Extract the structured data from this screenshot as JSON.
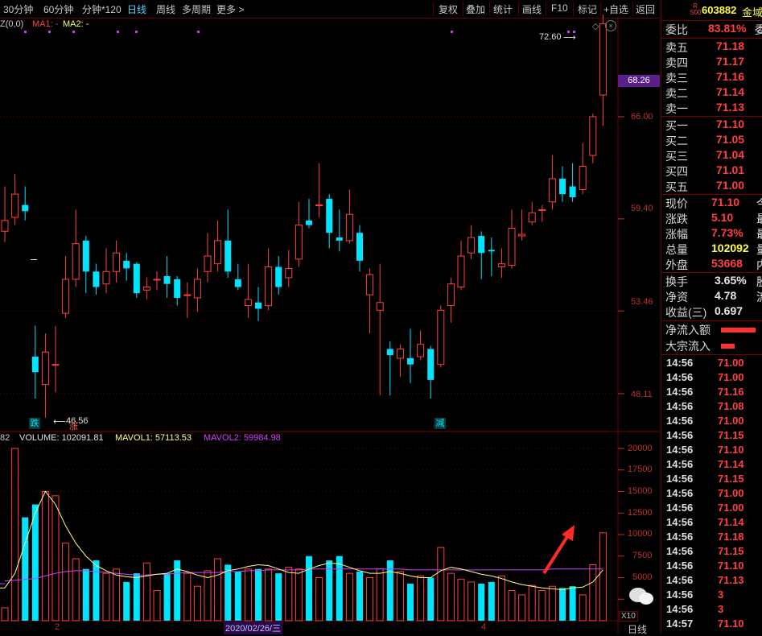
{
  "toolbar": {
    "items": [
      "30分钟",
      "60分钟",
      "分钟*120",
      "日线",
      "周线",
      "多周期",
      "更多 >"
    ],
    "right_items": [
      "复权",
      "叠加",
      "统计",
      "画线",
      "F10",
      "标记",
      "+自选",
      "返回"
    ],
    "active_index": 3
  },
  "price_legend": {
    "prefix": "Z(0,0)",
    "ma1": "MA1: -",
    "ma2": "MA2: -"
  },
  "volume_legend": {
    "prefix": "82",
    "volume": "VOLUME: 102091.81",
    "mavol1": "MAVOL1: 57113.53",
    "mavol2": "MAVOL2: 59984.98"
  },
  "price_axis": {
    "labels": [
      "66.00",
      "59.40",
      "53.46",
      "48.11"
    ],
    "current_price_tag": "68.26"
  },
  "volume_axis": {
    "labels": [
      "20000",
      "17500",
      "15000",
      "12500",
      "10000",
      "7500",
      "5000",
      "2500"
    ],
    "unit": "X10"
  },
  "annotations": {
    "high_label": "72.60",
    "low_label": "46.56",
    "marker_die": "跌",
    "marker_zhang": "涨",
    "marker_jian": "减"
  },
  "date_axis": {
    "tick_left": "2",
    "tick_date": "2020/02/26/三",
    "tick_right": "4",
    "period": "日线"
  },
  "stock": {
    "badge_top": "R",
    "badge_bottom": "500",
    "code": "603882",
    "name": "金域"
  },
  "order_book": {
    "weibi_label": "委比",
    "weibi_value": "83.81%",
    "weibi_extra": "委",
    "asks": [
      {
        "label": "卖五",
        "price": "71.18"
      },
      {
        "label": "卖四",
        "price": "71.17"
      },
      {
        "label": "卖三",
        "price": "71.16"
      },
      {
        "label": "卖二",
        "price": "71.14"
      },
      {
        "label": "卖一",
        "price": "71.13"
      }
    ],
    "bids": [
      {
        "label": "买一",
        "price": "71.10"
      },
      {
        "label": "买二",
        "price": "71.05"
      },
      {
        "label": "买三",
        "price": "71.04"
      },
      {
        "label": "买四",
        "price": "71.01"
      },
      {
        "label": "买五",
        "price": "71.00"
      }
    ]
  },
  "quote": [
    {
      "label": "现价",
      "value": "71.10",
      "color": "red",
      "extra": "今"
    },
    {
      "label": "涨跌",
      "value": "5.10",
      "color": "red",
      "extra": "最"
    },
    {
      "label": "涨幅",
      "value": "7.73%",
      "color": "red",
      "extra": "最"
    },
    {
      "label": "总量",
      "value": "102092",
      "color": "yellow",
      "extra": "量"
    },
    {
      "label": "外盘",
      "value": "53668",
      "color": "red",
      "extra": "内"
    }
  ],
  "stats": [
    {
      "label": "换手",
      "value": "3.65%",
      "extra": "股"
    },
    {
      "label": "净资",
      "value": "4.78",
      "extra": "流"
    },
    {
      "label": "收益(三)",
      "value": "0.697",
      "extra": ""
    }
  ],
  "flows": [
    {
      "label": "净流入额",
      "bar_fraction": 0.9
    },
    {
      "label": "大宗流入",
      "bar_fraction": 0.35
    }
  ],
  "ticks": [
    {
      "time": "14:56",
      "price": "71.00"
    },
    {
      "time": "14:56",
      "price": "71.00"
    },
    {
      "time": "14:56",
      "price": "71.16"
    },
    {
      "time": "14:56",
      "price": "71.08"
    },
    {
      "time": "14:56",
      "price": "71.00"
    },
    {
      "time": "14:56",
      "price": "71.15"
    },
    {
      "time": "14:56",
      "price": "71.10"
    },
    {
      "time": "14:56",
      "price": "71.14"
    },
    {
      "time": "14:56",
      "price": "71.15"
    },
    {
      "time": "14:56",
      "price": "71.00"
    },
    {
      "time": "14:56",
      "price": "71.00"
    },
    {
      "time": "14:56",
      "price": "71.14"
    },
    {
      "time": "14:56",
      "price": "71.18"
    },
    {
      "time": "14:56",
      "price": "71.15"
    },
    {
      "time": "14:56",
      "price": "71.10"
    },
    {
      "time": "14:56",
      "price": "71.13"
    },
    {
      "time": "14:56",
      "price": "3"
    },
    {
      "time": "14:56",
      "price": "3"
    },
    {
      "time": "14:57",
      "price": "71.10"
    }
  ],
  "colors": {
    "up": "#ff4040",
    "down": "#00e5ff",
    "mavol1": "#ffff80",
    "mavol2": "#d040ff",
    "grid": "#700000"
  },
  "chart_data": {
    "type": "candlestick",
    "y_axis_ticks": [
      66.0,
      59.4,
      53.46,
      48.11
    ],
    "high": 72.6,
    "low": 46.56,
    "candles": [
      {
        "o": 58.6,
        "c": 59.3,
        "h": 61.5,
        "l": 57.9
      },
      {
        "o": 59.5,
        "c": 61.0,
        "h": 62.3,
        "l": 59.0
      },
      {
        "o": 60.3,
        "c": 59.9,
        "h": 61.5,
        "l": 59.3
      },
      {
        "o": 50.5,
        "c": 49.5,
        "h": 52.5,
        "l": 47.8
      },
      {
        "o": 48.7,
        "c": 50.8,
        "h": 52.0,
        "l": 46.56
      },
      {
        "o": 50.0,
        "c": 50.0,
        "h": 52.5,
        "l": 48.2
      },
      {
        "o": 53.3,
        "c": 55.5,
        "h": 57.0,
        "l": 53.0
      },
      {
        "o": 55.5,
        "c": 57.8,
        "h": 60.0,
        "l": 55.0
      },
      {
        "o": 58.0,
        "c": 56.0,
        "h": 58.3,
        "l": 54.6
      },
      {
        "o": 56.0,
        "c": 55.0,
        "h": 56.5,
        "l": 54.5
      },
      {
        "o": 55.2,
        "c": 56.0,
        "h": 57.5,
        "l": 54.6
      },
      {
        "o": 56.0,
        "c": 57.2,
        "h": 58.0,
        "l": 55.3
      },
      {
        "o": 56.7,
        "c": 56.2,
        "h": 57.2,
        "l": 55.4
      },
      {
        "o": 56.5,
        "c": 54.6,
        "h": 56.6,
        "l": 54.3
      },
      {
        "o": 54.8,
        "c": 55.0,
        "h": 55.6,
        "l": 54.2
      },
      {
        "o": 55.5,
        "c": 55.5,
        "h": 56.0,
        "l": 54.8
      },
      {
        "o": 55.7,
        "c": 55.2,
        "h": 57.0,
        "l": 54.3
      },
      {
        "o": 55.5,
        "c": 54.3,
        "h": 55.7,
        "l": 53.8
      },
      {
        "o": 54.5,
        "c": 54.5,
        "h": 55.3,
        "l": 53.0
      },
      {
        "o": 54.3,
        "c": 55.5,
        "h": 56.2,
        "l": 53.4
      },
      {
        "o": 56.0,
        "c": 57.0,
        "h": 58.5,
        "l": 55.3
      },
      {
        "o": 56.5,
        "c": 58.0,
        "h": 59.3,
        "l": 56.0
      },
      {
        "o": 58.0,
        "c": 56.0,
        "h": 60.0,
        "l": 55.6
      },
      {
        "o": 55.5,
        "c": 55.0,
        "h": 56.5,
        "l": 54.8
      },
      {
        "o": 53.8,
        "c": 54.2,
        "h": 56.5,
        "l": 53.0
      },
      {
        "o": 54.0,
        "c": 53.6,
        "h": 55.0,
        "l": 52.8
      },
      {
        "o": 53.8,
        "c": 56.3,
        "h": 57.5,
        "l": 53.5
      },
      {
        "o": 56.3,
        "c": 55.0,
        "h": 57.0,
        "l": 54.5
      },
      {
        "o": 55.6,
        "c": 56.2,
        "h": 57.4,
        "l": 55.0
      },
      {
        "o": 56.8,
        "c": 59.0,
        "h": 60.5,
        "l": 56.3
      },
      {
        "o": 59.3,
        "c": 59.0,
        "h": 60.7,
        "l": 58.8
      },
      {
        "o": 60.3,
        "c": 60.3,
        "h": 63.0,
        "l": 59.5
      },
      {
        "o": 60.7,
        "c": 58.5,
        "h": 61.0,
        "l": 57.5
      },
      {
        "o": 58.2,
        "c": 58.0,
        "h": 60.0,
        "l": 57.3
      },
      {
        "o": 58.0,
        "c": 59.7,
        "h": 61.3,
        "l": 57.8
      },
      {
        "o": 58.5,
        "c": 56.7,
        "h": 59.0,
        "l": 56.0
      },
      {
        "o": 54.5,
        "c": 55.8,
        "h": 56.2,
        "l": 52.0
      },
      {
        "o": 53.5,
        "c": 54.0,
        "h": 56.5,
        "l": 48.0
      },
      {
        "o": 51.0,
        "c": 50.6,
        "h": 51.5,
        "l": 48.0
      },
      {
        "o": 50.4,
        "c": 51.0,
        "h": 51.3,
        "l": 49.2
      },
      {
        "o": 50.4,
        "c": 50.0,
        "h": 52.3,
        "l": 48.8
      },
      {
        "o": 50.5,
        "c": 51.3,
        "h": 52.2,
        "l": 50.3
      },
      {
        "o": 51.0,
        "c": 49.0,
        "h": 51.2,
        "l": 47.8
      },
      {
        "o": 50.0,
        "c": 53.5,
        "h": 53.8,
        "l": 49.8
      },
      {
        "o": 53.8,
        "c": 55.2,
        "h": 55.6,
        "l": 52.7
      },
      {
        "o": 55.0,
        "c": 57.0,
        "h": 58.0,
        "l": 54.8
      },
      {
        "o": 57.2,
        "c": 58.2,
        "h": 59.0,
        "l": 56.8
      },
      {
        "o": 58.3,
        "c": 57.2,
        "h": 58.6,
        "l": 55.5
      },
      {
        "o": 57.4,
        "c": 57.3,
        "h": 58.2,
        "l": 55.7
      },
      {
        "o": 56.3,
        "c": 56.5,
        "h": 57.5,
        "l": 55.6
      },
      {
        "o": 56.4,
        "c": 58.8,
        "h": 60.0,
        "l": 56.2
      },
      {
        "o": 58.3,
        "c": 58.4,
        "h": 60.0,
        "l": 58.0
      },
      {
        "o": 59.2,
        "c": 59.8,
        "h": 60.5,
        "l": 59.0
      },
      {
        "o": 60.0,
        "c": 60.0,
        "h": 60.3,
        "l": 59.2
      },
      {
        "o": 60.5,
        "c": 62.0,
        "h": 63.5,
        "l": 60.0
      },
      {
        "o": 62.0,
        "c": 61.0,
        "h": 62.8,
        "l": 60.5
      },
      {
        "o": 61.5,
        "c": 60.8,
        "h": 63.0,
        "l": 60.5
      },
      {
        "o": 61.3,
        "c": 62.8,
        "h": 64.3,
        "l": 61.0
      },
      {
        "o": 63.5,
        "c": 66.0,
        "h": 66.2,
        "l": 63.0
      },
      {
        "o": 67.4,
        "c": 72.0,
        "h": 72.6,
        "l": 65.4
      }
    ],
    "volume": {
      "mavol1_name": "MAVOL1",
      "mavol2_name": "MAVOL2",
      "bars": [
        0,
        0,
        0,
        0,
        0,
        0,
        0,
        0,
        0,
        0,
        0,
        0,
        0,
        0,
        0,
        0,
        0,
        0,
        0,
        0,
        0,
        0,
        0,
        0,
        0,
        0,
        0,
        0,
        0,
        0,
        0,
        0,
        0,
        0,
        0,
        0,
        0,
        0,
        0,
        0,
        0,
        0,
        0,
        0,
        0,
        0,
        0,
        0,
        0,
        0,
        0,
        0,
        0,
        0,
        0,
        0,
        0,
        0,
        0,
        0
      ],
      "values": [
        1500,
        20000,
        12000,
        13500,
        15000,
        14500,
        9000,
        7200,
        6000,
        7000,
        5500,
        6000,
        4500,
        5500,
        6700,
        3500,
        5500,
        7000,
        5500,
        4000,
        5800,
        7200,
        6500,
        5700,
        6000,
        6000,
        6000,
        5500,
        6200,
        6000,
        7500,
        5000,
        7000,
        7500,
        5500,
        5700,
        5000,
        6000,
        7000,
        5700,
        4300,
        5200,
        5000,
        8500,
        5500,
        4800,
        4500,
        4300,
        4500,
        5200,
        3500,
        3000,
        4100,
        3500,
        4000,
        3800,
        4000,
        3000,
        6500,
        10200
      ],
      "mavol1": [
        3800,
        5500,
        9000,
        12500,
        15000,
        13500,
        11000,
        9000,
        7500,
        6400,
        5800,
        5300,
        5100,
        5000,
        5200,
        5400,
        5500,
        6000,
        5700,
        5300,
        5000,
        5300,
        5800,
        6000,
        6300,
        6500,
        6400,
        6000,
        5600,
        5500,
        6000,
        6400,
        6700,
        6600,
        6200,
        5800,
        5500,
        5500,
        5700,
        5500,
        5200,
        5000,
        5000,
        5800,
        6200,
        6000,
        5700,
        5400,
        5200,
        4900,
        4500,
        4200,
        4000,
        3800,
        3700,
        3600,
        3800,
        3900,
        4500,
        5900
      ],
      "mavol2": [
        4600,
        4700,
        4800,
        4900,
        5200,
        5500,
        5700,
        5800,
        5800,
        5700,
        5600,
        5500,
        5400,
        5300,
        5300,
        5400,
        5400,
        5500,
        5600,
        5600,
        5600,
        5600,
        5700,
        5700,
        5800,
        5800,
        5900,
        5900,
        5900,
        5900,
        6000,
        6000,
        6000,
        6000,
        6000,
        6000,
        6000,
        6000,
        6000,
        6000,
        5900,
        5900,
        5900,
        5900,
        5900,
        5900,
        5900,
        5900,
        5900,
        5900,
        5900,
        5900,
        5900,
        5900,
        6000,
        6000,
        6000,
        6000,
        6000,
        6000
      ]
    }
  }
}
